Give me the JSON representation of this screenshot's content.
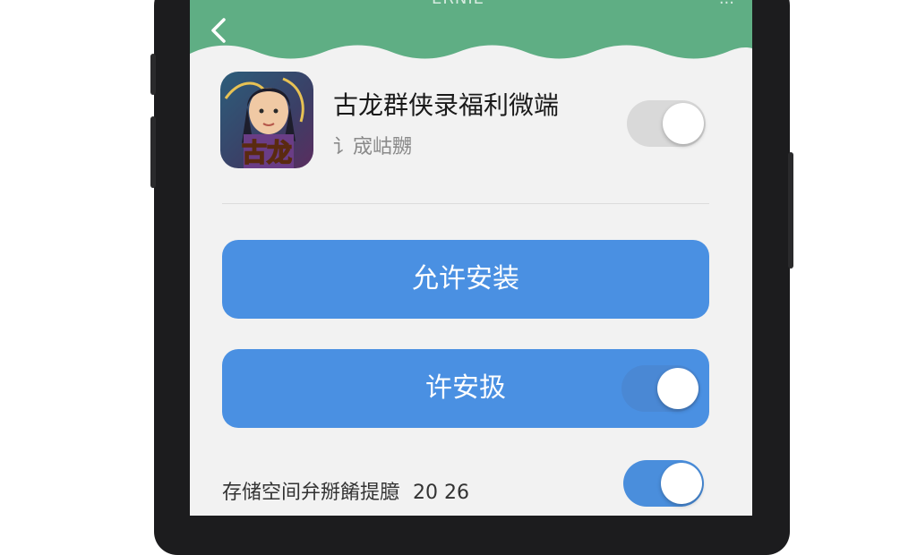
{
  "status_bar": {
    "center_text": "ERNIE",
    "right_text": "..."
  },
  "app": {
    "name": "古龙群侠录福利微端",
    "subtitle": "讠宬岵嬲"
  },
  "buttons": {
    "allow_install_label": "允许安装",
    "second_label": "许安扱"
  },
  "storage_row": {
    "label": "存储空间弁掰餚提臆",
    "value": "20 26"
  },
  "icon_overlay_text": "古龙",
  "toggles": {
    "app_toggle_on": false,
    "button_toggle_on": true,
    "storage_toggle_on": true
  },
  "colors": {
    "header_green": "#5fae84",
    "button_blue": "#4a90e2",
    "toggle_blue": "#4a8edc",
    "toggle_gray": "#d9d9d9"
  },
  "icons": [
    "back-arrow-icon",
    "app-icon"
  ]
}
